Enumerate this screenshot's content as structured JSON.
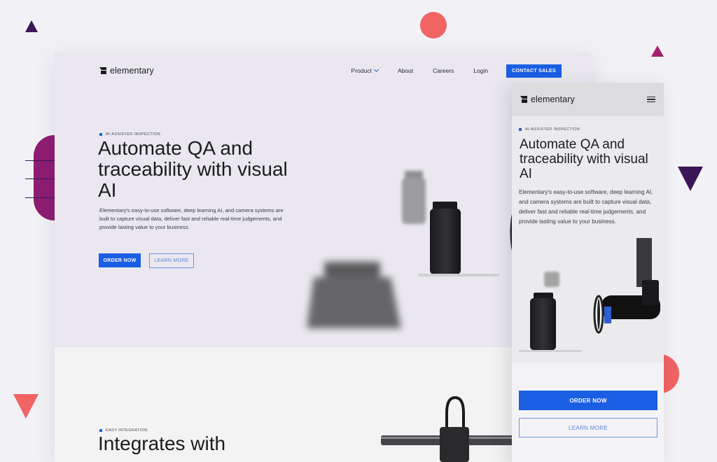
{
  "brand": {
    "name": "elementary"
  },
  "desktop": {
    "nav": {
      "items": [
        {
          "label": "Product",
          "has_dropdown": true
        },
        {
          "label": "About"
        },
        {
          "label": "Careers"
        },
        {
          "label": "Login"
        }
      ],
      "cta": "CONTACT SALES"
    },
    "hero": {
      "eyebrow": "AI-ASSISTED INSPECTION",
      "title": "Automate QA and traceability with visual AI",
      "description": "Elementary's easy-to-use software, deep learning AI, and camera systems are built to capture visual data, deliver fast and reliable real-time judgements, and provide lasting value to your business.",
      "primary_button": "ORDER NOW",
      "secondary_button": "LEARN MORE"
    },
    "section2": {
      "eyebrow": "EASY INTEGRATION",
      "title": "Integrates with"
    }
  },
  "mobile": {
    "eyebrow": "AI-ASSISTED INSPECTION",
    "title": "Automate QA and traceability with visual AI",
    "description": "Elementary's easy-to-use software, deep learning AI, and camera systems are built to capture visual data, deliver fast and reliable real-time judgements, and provide lasting value to your business.",
    "primary_button": "ORDER NOW",
    "secondary_button": "LEARN MORE"
  },
  "colors": {
    "accent_blue": "#1a5ee3",
    "coral": "#f26363",
    "deep_purple": "#3b1556",
    "magenta": "#8e1d72",
    "background": "#f2f2f6"
  }
}
